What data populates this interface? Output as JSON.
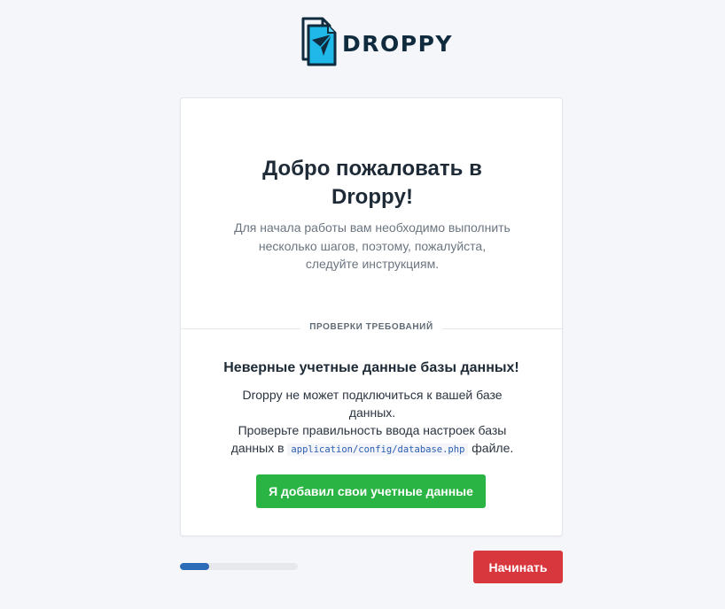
{
  "header": {
    "logo_text": "DROPPY",
    "logo_icon": "paper-plane-document-icon"
  },
  "welcome": {
    "title": "Добро пожаловать в Droppy!",
    "description": "Для начала работы вам необходимо выполнить несколько шагов, поэтому, пожалуйста, следуйте инструкциям."
  },
  "requirements": {
    "section_label": "ПРОВЕРКИ ТРЕБОВАНИЙ",
    "error_title": "Неверные учетные данные базы данных!",
    "error_line1": "Droppy не может подключиться к вашей базе данных.",
    "error_line2_before": "Проверьте правильность ввода настроек базы данных в",
    "config_path": "application/config/database.php",
    "error_line2_after": "файле.",
    "added_button": "Я добавил свои учетные данные"
  },
  "footer": {
    "progress": 0.25,
    "start_button": "Начинать"
  },
  "colors": {
    "background": "#f4f6fa",
    "success": "#2ab443",
    "danger": "#d8373d",
    "progress": "#2d6bb7",
    "logo_accent": "#1fb8e8",
    "logo_dark": "#0f2b3d"
  }
}
